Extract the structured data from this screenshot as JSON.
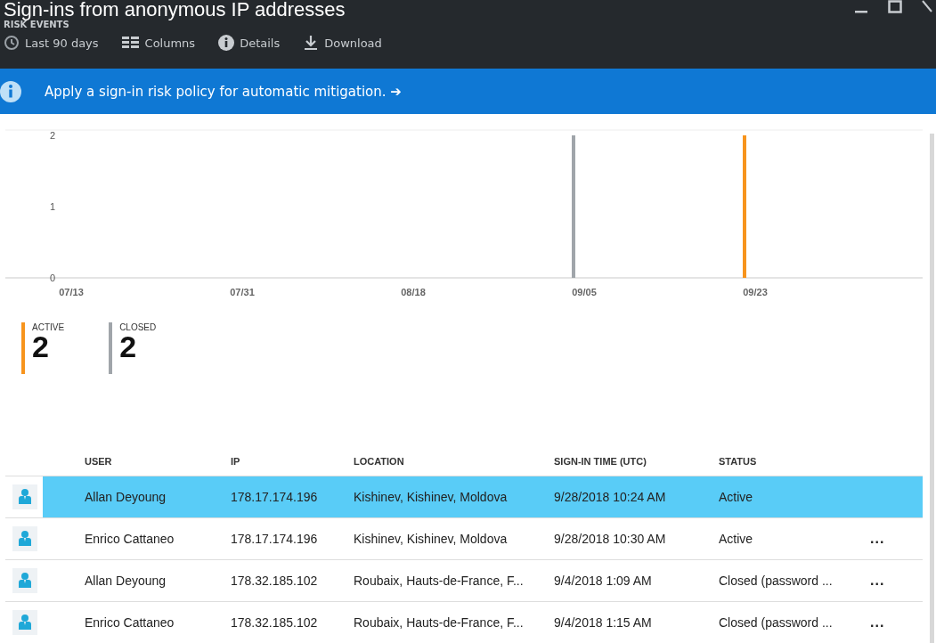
{
  "window": {
    "title": "Sign-ins from anonymous IP addresses",
    "subtitle": "RISK EVENTS"
  },
  "toolbar": [
    {
      "kind": "clock",
      "label": "Last 90 days"
    },
    {
      "kind": "columns",
      "label": "Columns"
    },
    {
      "kind": "info",
      "label": "Details"
    },
    {
      "kind": "download",
      "label": "Download"
    }
  ],
  "banner": {
    "text": "Apply a sign-in risk policy for automatic mitigation.",
    "arrow": "➔"
  },
  "chart": {
    "chart_data": {
      "type": "bar",
      "categories": [
        "07/13",
        "07/31",
        "08/18",
        "09/05",
        "09/23"
      ],
      "stacked": true,
      "ylim": [
        0,
        2
      ],
      "yticks": [
        0,
        1,
        2
      ],
      "series": [
        {
          "name": "ACTIVE",
          "color": "#f7941d",
          "values": [
            null,
            null,
            null,
            null,
            2
          ]
        },
        {
          "name": "CLOSED",
          "color": "#a0a5aa",
          "values": [
            null,
            null,
            null,
            2,
            null
          ]
        }
      ]
    }
  },
  "legend": [
    {
      "count": "2"
    },
    {
      "count": "2"
    }
  ],
  "table": {
    "columns": [
      "USER",
      "IP",
      "LOCATION",
      "SIGN-IN TIME (UTC)",
      "STATUS"
    ],
    "rows": [
      {
        "cells": [
          "Allan Deyoung",
          "178.17.174.196",
          "Kishinev, Kishinev, Moldova",
          "9/28/2018 10:24 AM",
          "Active"
        ],
        "selected": true
      },
      {
        "cells": [
          "Enrico Cattaneo",
          "178.17.174.196",
          "Kishinev, Kishinev, Moldova",
          "9/28/2018 10:30 AM",
          "Active"
        ],
        "selected": false,
        "more": "..."
      },
      {
        "cells": [
          "Allan Deyoung",
          "178.32.185.102",
          "Roubaix, Hauts-de-France, F...",
          "9/4/2018 1:09 AM",
          "Closed (password ..."
        ],
        "selected": false,
        "more": "..."
      },
      {
        "cells": [
          "Enrico Cattaneo",
          "178.32.185.102",
          "Roubaix, Hauts-de-France, F...",
          "9/4/2018 1:15 AM",
          "Closed (password ..."
        ],
        "selected": false,
        "more": "..."
      }
    ]
  }
}
